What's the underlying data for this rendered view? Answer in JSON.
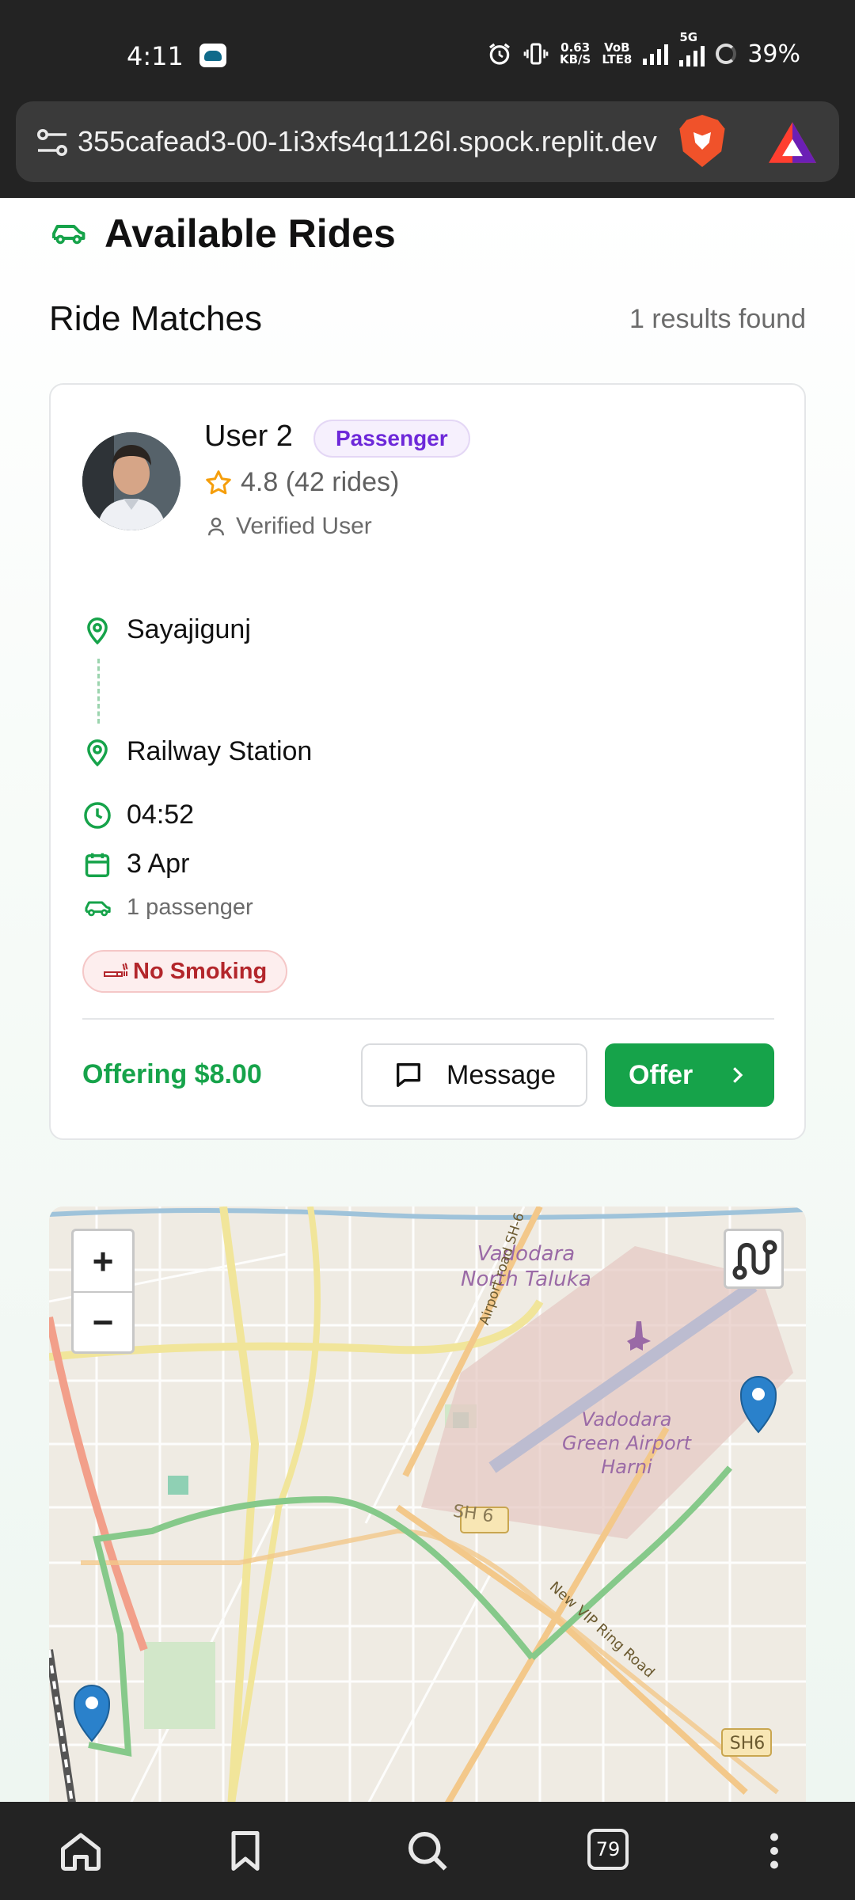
{
  "status_bar": {
    "time": "4:11",
    "net_speed_value": "0.63",
    "net_speed_unit": "KB/S",
    "volte_top": "VoB",
    "volte_bottom": "LTE8",
    "network_type": "5G",
    "battery": "39%"
  },
  "browser": {
    "url": "355cafead3-00-1i3xfs4q1126l.spock.replit.dev",
    "tabs_count": "79"
  },
  "page": {
    "title": "Available Rides",
    "section_title": "Ride Matches",
    "results_count": "1 results found"
  },
  "ride_card": {
    "user_name": "User 2",
    "role": "Passenger",
    "rating": "4.8 (42 rides)",
    "verified": "Verified User",
    "pickup": "Sayajigunj",
    "dropoff": "Railway Station",
    "time": "04:52",
    "date": "3 Apr",
    "passengers": "1 passenger",
    "preference_tag": "No Smoking",
    "offering": "Offering $8.00",
    "message_label": "Message",
    "offer_label": "Offer"
  },
  "map": {
    "zoom_in": "+",
    "zoom_out": "−",
    "labels": {
      "taluka_line1": "Vadodara",
      "taluka_line2": "North Taluka",
      "airport_line1": "Vadodara",
      "airport_line2": "Green Airport",
      "airport_line3": "Harni",
      "airport_road": "Airport road SH-6",
      "highway_sh6": "SH 6",
      "highway_badge": "SH6",
      "road_name": "New VIP Ring Road"
    }
  },
  "colors": {
    "brand_green": "#16a34a",
    "role_purple": "#6d28d9",
    "tag_red": "#b3262b",
    "star": "#f59e0b",
    "route": "#86c98a",
    "marker": "#2a81cb"
  }
}
